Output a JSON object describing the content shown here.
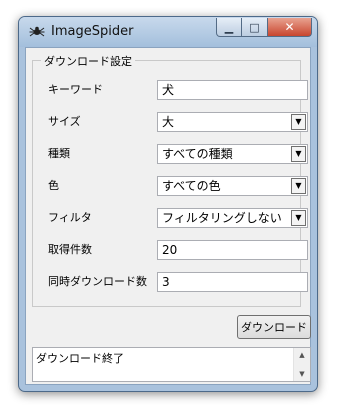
{
  "window": {
    "title": "ImageSpider",
    "minimize_glyph": "▁",
    "maximize_glyph": "□",
    "close_glyph": "✕"
  },
  "group": {
    "title": "ダウンロード設定"
  },
  "fields": {
    "keyword": {
      "label": "キーワード",
      "value": "犬"
    },
    "size": {
      "label": "サイズ",
      "value": "大"
    },
    "type": {
      "label": "種類",
      "value": "すべての種類"
    },
    "color": {
      "label": "色",
      "value": "すべての色"
    },
    "filter": {
      "label": "フィルタ",
      "value": "フィルタリングしない"
    },
    "count": {
      "label": "取得件数",
      "value": "20"
    },
    "concurrent": {
      "label": "同時ダウンロード数",
      "value": "3"
    }
  },
  "icons": {
    "dropdown_arrow": "▼",
    "scroll_up": "▲",
    "scroll_down": "▼"
  },
  "download_button": {
    "label": "ダウンロード"
  },
  "status": {
    "text": "ダウンロード終了"
  }
}
